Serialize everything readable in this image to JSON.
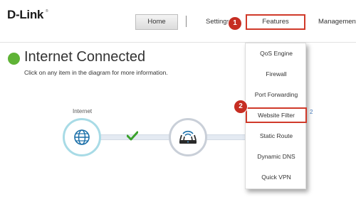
{
  "brand": {
    "logo": "D-Link",
    "logo_mark": "®"
  },
  "nav": {
    "home": "Home",
    "settings": "Settings",
    "features": "Features",
    "management": "Management"
  },
  "status": {
    "title": "Internet Connected",
    "subtitle": "Click on any item in the diagram for more information.",
    "indicator_color": "#5fb336"
  },
  "diagram": {
    "internet_label": "Internet",
    "side_number": "2"
  },
  "features_menu": {
    "items": [
      "QoS Engine",
      "Firewall",
      "Port Forwarding",
      "Website Filter",
      "Static Route",
      "Dynamic DNS",
      "Quick VPN"
    ],
    "highlighted": "Website Filter"
  },
  "steps": {
    "step1": "1",
    "step2": "2"
  },
  "colors": {
    "accent": "#d03a2a",
    "badge": "#c62d22",
    "check": "#3aa12b"
  }
}
